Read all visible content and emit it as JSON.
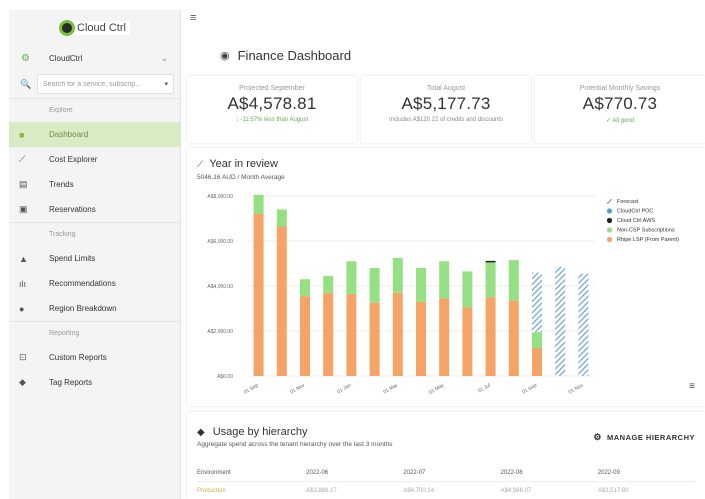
{
  "brand": {
    "name": "Cloud Ctrl"
  },
  "tenant": {
    "name": "CloudCtrl"
  },
  "search": {
    "placeholder": "Search for a service, subscrip..."
  },
  "sidebar": {
    "sections": {
      "explore": "Explore",
      "tracking": "Tracking",
      "reporting": "Reporting"
    },
    "items": [
      {
        "label": "Dashboard",
        "icon": "dashboard-icon"
      },
      {
        "label": "Cost Explorer",
        "icon": "chart-line-icon"
      },
      {
        "label": "Trends",
        "icon": "trends-icon"
      },
      {
        "label": "Reservations",
        "icon": "reservations-icon"
      },
      {
        "label": "Spend Limits",
        "icon": "bell-icon"
      },
      {
        "label": "Recommendations",
        "icon": "bars-icon"
      },
      {
        "label": "Region Breakdown",
        "icon": "pin-icon"
      },
      {
        "label": "Custom Reports",
        "icon": "report-icon"
      },
      {
        "label": "Tag Reports",
        "icon": "tag-icon"
      }
    ]
  },
  "header": {
    "title": "Finance Dashboard"
  },
  "kpis": [
    {
      "label": "Projected September",
      "value": "A$4,578.81",
      "sub": "-11.57% less than August",
      "sub_color": "#6aa84f"
    },
    {
      "label": "Total August",
      "value": "A$5,177.73",
      "sub": "Includes A$120.22 of credits and discounts"
    },
    {
      "label": "Potential Monthly Savings",
      "value": "A$770.73",
      "sub": "All good",
      "sub_color": "#6aa84f"
    }
  ],
  "year_review": {
    "title": "Year in review",
    "subtitle": "5046.16 AUD / Month Average"
  },
  "chart_data": {
    "type": "bar",
    "stacked": true,
    "ylim": [
      0,
      8000
    ],
    "yticks": [
      "A$0.00",
      "A$2,000.00",
      "A$4,000.00",
      "A$6,000.00",
      "A$8,000.00"
    ],
    "ytick_values": [
      0,
      2000,
      4000,
      6000,
      8000
    ],
    "categories": [
      "Sep 21",
      "Oct 21",
      "Nov 21",
      "Dec 21",
      "Jan 22",
      "Feb 22",
      "Mar 22",
      "Apr 22",
      "May 22",
      "Jun 22",
      "Jul 22",
      "Aug 22",
      "Sep 22",
      "Oct 22",
      "Nov 22"
    ],
    "xtick_labels": [
      "01 Sep",
      "01 Nov",
      "01 Jan",
      "01 Mar",
      "01 May",
      "01 Jul",
      "01 Sep",
      "01 Nov"
    ],
    "xtick_index": [
      0,
      2,
      4,
      6,
      8,
      10,
      12,
      14
    ],
    "series": [
      {
        "name": "Rhipe LSP (From Parent)",
        "color": "#f4a466",
        "values": [
          7200,
          6650,
          3550,
          3700,
          3650,
          3250,
          3700,
          3300,
          3450,
          3050,
          3500,
          3350,
          1250,
          0,
          0
        ]
      },
      {
        "name": "Non-CSP Subscriptions",
        "color": "#95e082",
        "values": [
          850,
          750,
          750,
          750,
          1450,
          1550,
          1550,
          1500,
          1650,
          1600,
          1550,
          1800,
          700,
          0,
          0
        ]
      },
      {
        "name": "Cloud Ctrl AWS",
        "color": "#222222",
        "values": [
          0,
          0,
          0,
          0,
          0,
          0,
          0,
          0,
          0,
          0,
          60,
          0,
          0,
          0,
          0
        ]
      },
      {
        "name": "CloudCtrl POC",
        "color": "#5b9bd5",
        "values": [
          0,
          0,
          0,
          0,
          0,
          0,
          0,
          0,
          0,
          0,
          0,
          0,
          0,
          0,
          0
        ]
      },
      {
        "name": "Forecast",
        "color": "#5b9bd5",
        "pattern": "hatched",
        "values": [
          0,
          0,
          0,
          0,
          0,
          0,
          0,
          0,
          0,
          0,
          0,
          0,
          2650,
          4850,
          4550
        ]
      }
    ],
    "legend_position": "right"
  },
  "usage": {
    "title": "Usage by hierarchy",
    "subtitle": "Aggregate spend across the tenant hierarchy over the last 3 months",
    "manage_label": "MANAGE HIERARCHY",
    "columns": [
      "Environment",
      "2022-06",
      "2022-07",
      "2022-08",
      "2022-09"
    ],
    "rows": [
      [
        "Production",
        "A$3,886.17",
        "A$4,700.14",
        "A$4,986.07",
        "A$2,517.80"
      ]
    ]
  }
}
